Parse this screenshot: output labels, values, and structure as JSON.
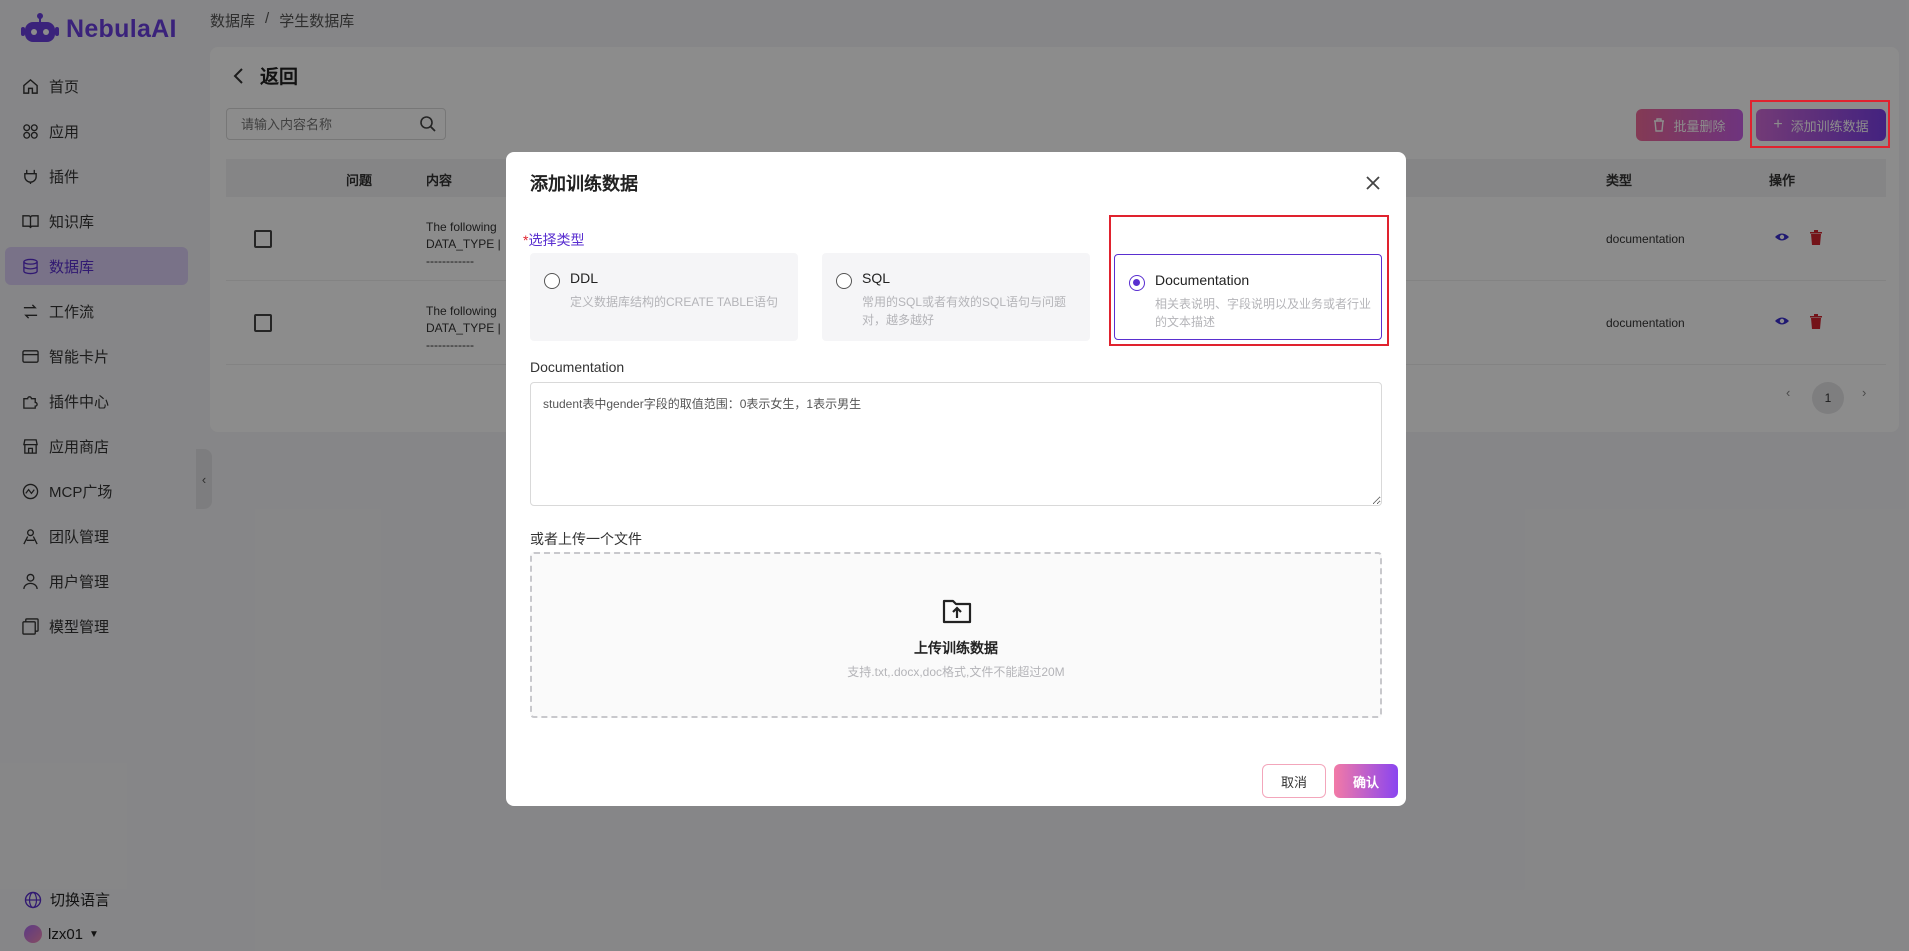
{
  "app": {
    "brand": "NebulaAI"
  },
  "sidebar": {
    "items": [
      {
        "label": "首页",
        "icon": "home-icon",
        "active": false
      },
      {
        "label": "应用",
        "icon": "apps-icon",
        "active": false
      },
      {
        "label": "插件",
        "icon": "plug-icon",
        "active": false
      },
      {
        "label": "知识库",
        "icon": "book-icon",
        "active": false
      },
      {
        "label": "数据库",
        "icon": "database-icon",
        "active": true
      },
      {
        "label": "工作流",
        "icon": "workflow-icon",
        "active": false
      },
      {
        "label": "智能卡片",
        "icon": "card-icon",
        "active": false
      },
      {
        "label": "插件中心",
        "icon": "puzzle-icon",
        "active": false
      },
      {
        "label": "应用商店",
        "icon": "store-icon",
        "active": false
      },
      {
        "label": "MCP广场",
        "icon": "mcp-icon",
        "active": false
      },
      {
        "label": "团队管理",
        "icon": "team-icon",
        "active": false
      },
      {
        "label": "用户管理",
        "icon": "user-icon",
        "active": false
      },
      {
        "label": "模型管理",
        "icon": "model-icon",
        "active": false
      }
    ],
    "language": "切换语言",
    "username": "lzx01"
  },
  "breadcrumb": {
    "root": "数据库",
    "sep": "/",
    "current": "学生数据库"
  },
  "page": {
    "back_label": "返回",
    "search_placeholder": "请输入内容名称",
    "batch_delete": "批量删除",
    "add_training": "添加训练数据",
    "columns": {
      "question": "问题",
      "content": "内容",
      "type": "类型",
      "actions": "操作"
    },
    "rows": [
      {
        "content": "The following\nDATA_TYPE | \n------------",
        "type": "documentation"
      },
      {
        "content": "The following\nDATA_TYPE | \n------------",
        "type": "documentation"
      }
    ],
    "pagination": {
      "current": "1"
    }
  },
  "modal": {
    "title": "添加训练数据",
    "type_label_star": "*",
    "type_label": "选择类型",
    "options": [
      {
        "title": "DDL",
        "desc": "定义数据库结构的CREATE TABLE语句",
        "selected": false
      },
      {
        "title": "SQL",
        "desc": "常用的SQL或者有效的SQL语句与问题对，越多越好",
        "selected": false
      },
      {
        "title": "Documentation",
        "desc": "相关表说明、字段说明以及业务或者行业的文本描述",
        "selected": true
      }
    ],
    "doc_label": "Documentation",
    "doc_value": "student表中gender字段的取值范围：0表示女生，1表示男生",
    "upload_label": "或者上传一个文件",
    "upload_title": "上传训练数据",
    "upload_hint": "支持.txt,.docx,doc格式,文件不能超过20M",
    "cancel": "取消",
    "confirm": "确认"
  },
  "colors": {
    "accent": "#5a2fd0",
    "highlight": "#e0222e",
    "danger": "#d4242f"
  }
}
